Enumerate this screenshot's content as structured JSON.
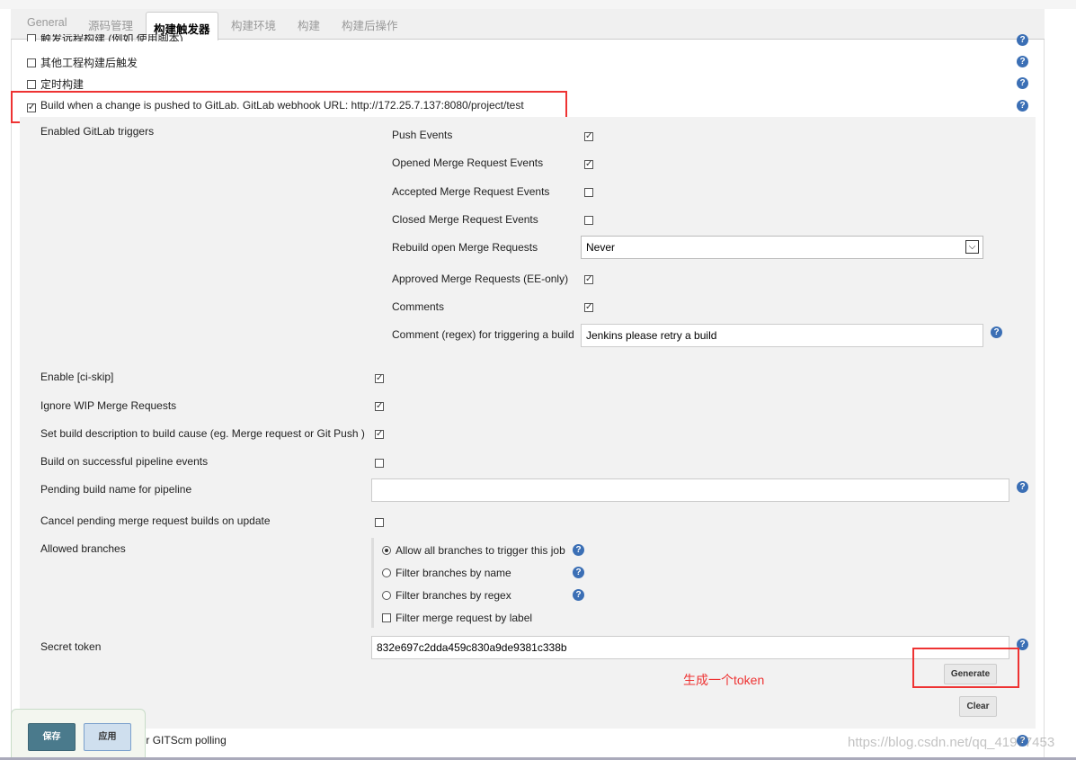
{
  "tabs": [
    "General",
    "源码管理",
    "构建触发器",
    "构建环境",
    "构建",
    "构建后操作"
  ],
  "triggers": {
    "remote": "触发远程构建 (例如,使用脚本)",
    "after_other": "其他工程构建后触发",
    "timer": "定时构建",
    "gitlab": "Build when a change is pushed to GitLab. GitLab webhook URL: http://172.25.7.137:8080/project/test",
    "github": "GitHub hook trigger for GITScm polling"
  },
  "gitlab": {
    "enabled_label": "Enabled GitLab triggers",
    "events": [
      {
        "label": "Push Events",
        "checked": true
      },
      {
        "label": "Opened Merge Request Events",
        "checked": true
      },
      {
        "label": "Accepted Merge Request Events",
        "checked": false
      },
      {
        "label": "Closed Merge Request Events",
        "checked": false
      }
    ],
    "rebuild_label": "Rebuild open Merge Requests",
    "rebuild_value": "Never",
    "approved": {
      "label": "Approved Merge Requests (EE-only)",
      "checked": true
    },
    "comments": {
      "label": "Comments",
      "checked": true
    },
    "comment_regex_label": "Comment (regex) for triggering a build",
    "comment_regex_value": "Jenkins please retry a build",
    "options": [
      {
        "label": "Enable [ci-skip]",
        "checked": true
      },
      {
        "label": "Ignore WIP Merge Requests",
        "checked": true
      },
      {
        "label": "Set build description to build cause (eg. Merge request or Git Push )",
        "checked": true
      },
      {
        "label": "Build on successful pipeline events",
        "checked": false
      }
    ],
    "pending_label": "Pending build name for pipeline",
    "pending_value": "",
    "cancel_label": "Cancel pending merge request builds on update",
    "allowed_label": "Allowed branches",
    "branches": [
      {
        "label": "Allow all branches to trigger this job",
        "selected": true
      },
      {
        "label": "Filter branches by name",
        "selected": false
      },
      {
        "label": "Filter branches by regex",
        "selected": false
      }
    ],
    "filter_label": "Filter merge request by label",
    "secret_label": "Secret token",
    "secret_value": "832e697c2dda459c830a9de9381c338b",
    "generate": "Generate",
    "clear": "Clear",
    "annotation": "生成一个token"
  },
  "footer": {
    "save": "保存",
    "apply": "应用"
  },
  "watermark": "https://blog.csdn.net/qq_41977453",
  "colors": {
    "accent": "#ee3333",
    "save": "#4a7a8c",
    "help": "#3b6fb5"
  }
}
